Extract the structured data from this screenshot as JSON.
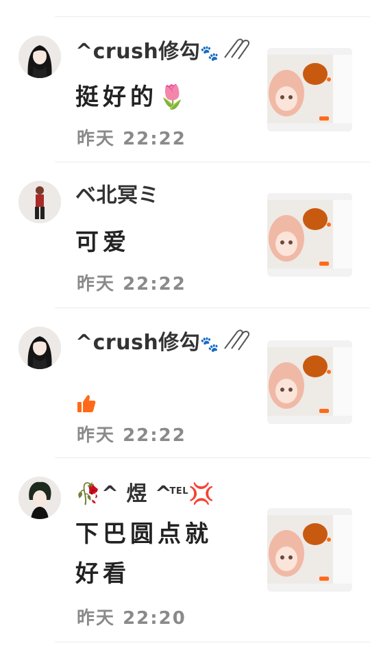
{
  "comments": [
    {
      "name": "^crush修勾",
      "name_deco": "🐾",
      "message": "挺好的🌷",
      "date_label": "昨天",
      "time": "22:22"
    },
    {
      "name": "ベ北冥ミ",
      "message": "可爱",
      "date_label": "昨天",
      "time": "22:22"
    },
    {
      "name": "^crush修勾",
      "name_deco": "🐾",
      "message": "",
      "date_label": "昨天",
      "time": "22:22"
    },
    {
      "name_prefix": "🥀^ 煜  ^",
      "name_tel": "TEL",
      "name_suffix": "💢",
      "message_line1": "下巴圆点就",
      "message_line2": "好看",
      "date_label": "昨天",
      "time": "22:20"
    }
  ],
  "colors": {
    "accent": "#ff6a1a",
    "time_text": "#8a8a8a",
    "divider": "#ececec"
  },
  "icons": {
    "thumbs_up": "thumbs-up-icon",
    "attachment": "paperclip-icon"
  }
}
